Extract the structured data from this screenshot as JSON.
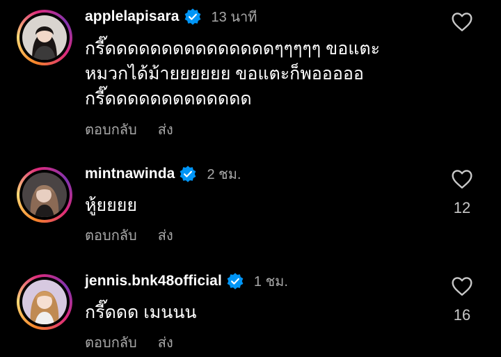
{
  "comments": [
    {
      "username": "applelapisara",
      "time": "13 นาที",
      "text": "กรี๊ดดดดดดดดดดดดดดดๆๆๆๆๆ ขอแตะ\nหมวกได้ม้ายยยยยย ขอแตะก็พอออออ\nกรี๊ดดดดดดดดดดดดด",
      "reply_label": "ตอบกลับ",
      "send_label": "ส่ง",
      "likes": ""
    },
    {
      "username": "mintnawinda",
      "time": "2 ชม.",
      "text": "หู้ยยยย",
      "reply_label": "ตอบกลับ",
      "send_label": "ส่ง",
      "likes": "12"
    },
    {
      "username": "jennis.bnk48official",
      "time": "1 ชม.",
      "text": "กรี๊ดดด เมนนน",
      "reply_label": "ตอบกลับ",
      "send_label": "ส่ง",
      "likes": "16"
    }
  ],
  "icons": {
    "verified": "verified-badge-icon",
    "like": "heart-outline-icon"
  },
  "colors": {
    "background": "#000000",
    "verified": "#0095f6",
    "secondary_text": "#a8a8a8"
  }
}
